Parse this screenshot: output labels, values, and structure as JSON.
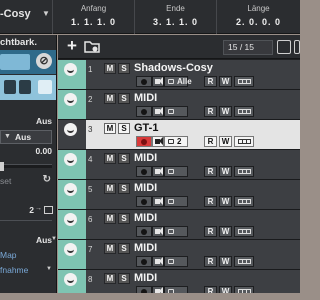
{
  "header": {
    "project_name_partial": "-Cosy",
    "columns": [
      {
        "label": "Anfang",
        "value": "1. 1. 1.   0"
      },
      {
        "label": "Ende",
        "value": "3. 1. 1.   0"
      },
      {
        "label": "Länge",
        "value": "2. 0. 0.   0"
      }
    ]
  },
  "inspector": {
    "title_partial": "chtbark.",
    "output_label": "Aus",
    "aus_box_label": "Aus",
    "volume_value": "0.00",
    "reset_label": "set",
    "channel_value": "2",
    "output2_label": "Aus",
    "map_label": "Map",
    "record_label": "fnahme"
  },
  "tracklist": {
    "track_count": "15 / 15",
    "tracks": [
      {
        "number": "1",
        "name": "Shadows-Cosy",
        "channel": "Alle",
        "selected": false
      },
      {
        "number": "2",
        "name": "MIDI",
        "channel": "",
        "selected": false
      },
      {
        "number": "3",
        "name": "GT-1",
        "channel": "2",
        "selected": true
      },
      {
        "number": "4",
        "name": "MIDI",
        "channel": "",
        "selected": false
      },
      {
        "number": "5",
        "name": "MIDI",
        "channel": "",
        "selected": false
      },
      {
        "number": "6",
        "name": "MIDI",
        "channel": "",
        "selected": false
      },
      {
        "number": "7",
        "name": "MIDI",
        "channel": "",
        "selected": false
      },
      {
        "number": "8",
        "name": "MIDI",
        "channel": "",
        "selected": false
      }
    ],
    "button_labels": {
      "mute": "M",
      "solo": "S",
      "read": "R",
      "write": "W"
    }
  },
  "colors": {
    "track_strip": "#7ec4b2",
    "selected_track": "#e4e4e4",
    "record_active": "#d93a3a",
    "inspector_blue": "#8fc3db"
  }
}
